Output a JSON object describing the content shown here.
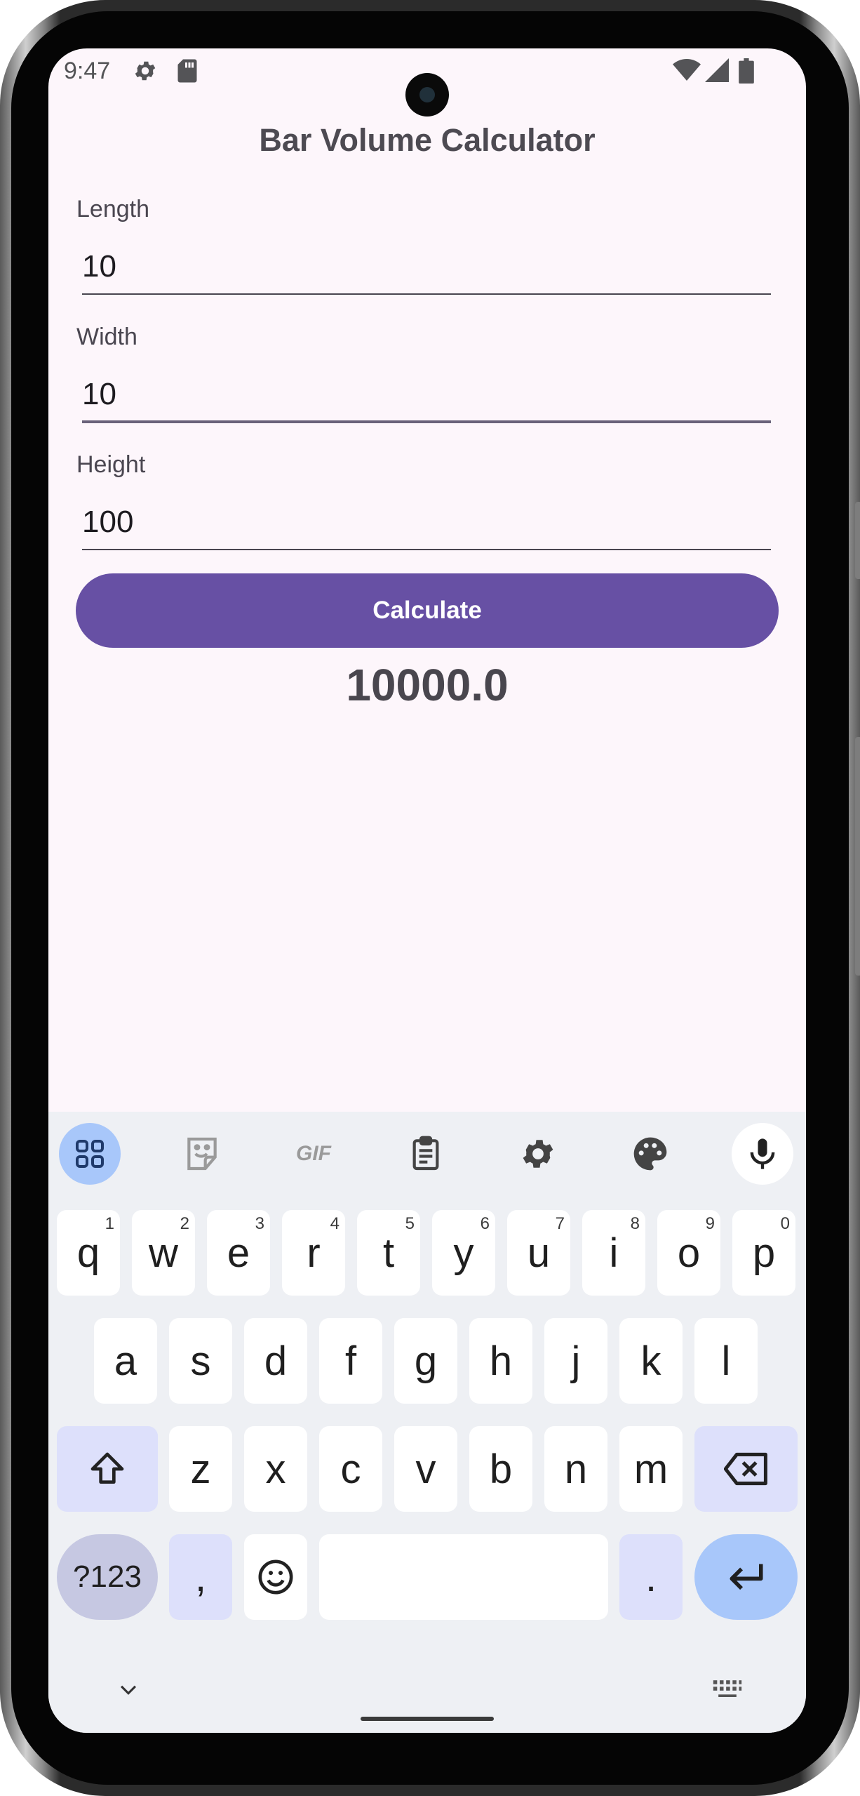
{
  "status_bar": {
    "time": "9:47",
    "icons": [
      "settings-icon",
      "sd-card-icon",
      "wifi-icon",
      "signal-icon",
      "battery-icon"
    ]
  },
  "app": {
    "title": "Bar Volume Calculator",
    "fields": [
      {
        "label": "Length",
        "value": "10"
      },
      {
        "label": "Width",
        "value": "10"
      },
      {
        "label": "Height",
        "value": "100"
      }
    ],
    "button_label": "Calculate",
    "result": "10000.0"
  },
  "keyboard": {
    "toolbar": [
      "apps-grid-icon",
      "sticker-icon",
      "gif-icon",
      "clipboard-icon",
      "gear-icon",
      "palette-icon",
      "mic-icon"
    ],
    "gif_label": "GIF",
    "row1": [
      {
        "k": "q",
        "n": "1"
      },
      {
        "k": "w",
        "n": "2"
      },
      {
        "k": "e",
        "n": "3"
      },
      {
        "k": "r",
        "n": "4"
      },
      {
        "k": "t",
        "n": "5"
      },
      {
        "k": "y",
        "n": "6"
      },
      {
        "k": "u",
        "n": "7"
      },
      {
        "k": "i",
        "n": "8"
      },
      {
        "k": "o",
        "n": "9"
      },
      {
        "k": "p",
        "n": "0"
      }
    ],
    "row2": [
      "a",
      "s",
      "d",
      "f",
      "g",
      "h",
      "j",
      "k",
      "l"
    ],
    "row3": [
      "z",
      "x",
      "c",
      "v",
      "b",
      "n",
      "m"
    ],
    "symbols_label": "?123",
    "comma": ",",
    "period": "."
  },
  "colors": {
    "background": "#fdf6fb",
    "primary": "#6750a4",
    "keyboard": "#eef0f4",
    "enter": "#a8c7fa"
  }
}
